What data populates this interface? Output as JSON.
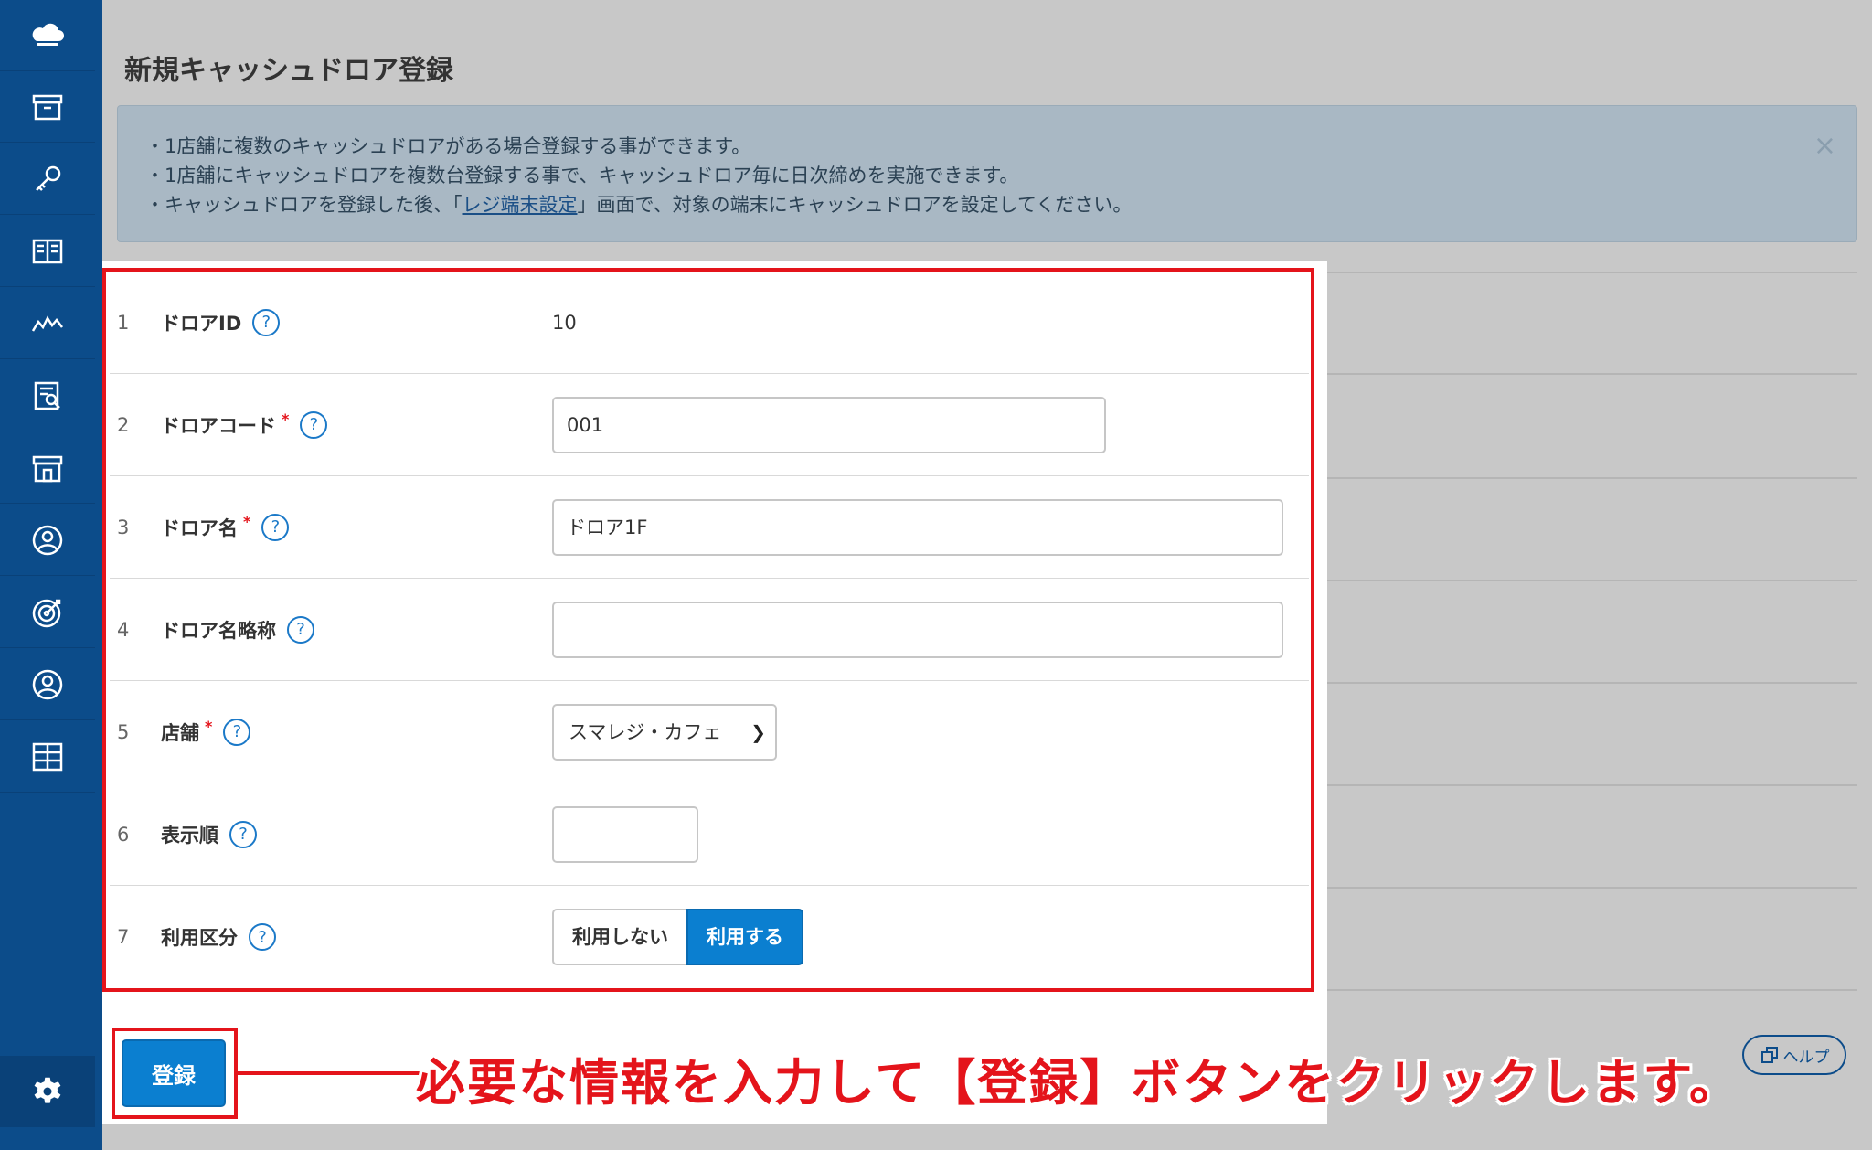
{
  "page": {
    "title": "新規キャッシュドロア登録"
  },
  "sidebar": {
    "items": [
      {
        "icon": "cloud-icon"
      },
      {
        "icon": "archive-icon"
      },
      {
        "icon": "key-icon"
      },
      {
        "icon": "book-icon"
      },
      {
        "icon": "chart-line-icon"
      },
      {
        "icon": "report-icon"
      },
      {
        "icon": "store-icon"
      },
      {
        "icon": "user-icon"
      },
      {
        "icon": "target-icon"
      },
      {
        "icon": "member-icon"
      },
      {
        "icon": "apps-icon"
      }
    ],
    "settings_icon": "gear-icon"
  },
  "alert": {
    "line1": "・1店舗に複数のキャッシュドロアがある場合登録する事ができます。",
    "line2": "・1店舗にキャッシュドロアを複数台登録する事で、キャッシュドロア毎に日次締めを実施できます。",
    "line3_prefix": "・キャッシュドロアを登録した後、「",
    "line3_link": "レジ端末設定",
    "line3_suffix": "」画面で、対象の端末にキャッシュドロアを設定してください。",
    "close": "×"
  },
  "form": {
    "rows": [
      {
        "num": "1",
        "label": "ドロアID",
        "value": "10"
      },
      {
        "num": "2",
        "label": "ドロアコード",
        "required_mark": "*",
        "value": "001"
      },
      {
        "num": "3",
        "label": "ドロア名",
        "required_mark": "*",
        "value": "ドロア1F"
      },
      {
        "num": "4",
        "label": "ドロア名略称",
        "value": ""
      },
      {
        "num": "5",
        "label": "店舗",
        "required_mark": "*",
        "value": "スマレジ・カフェ"
      },
      {
        "num": "6",
        "label": "表示順",
        "value": ""
      },
      {
        "num": "7",
        "label": "利用区分",
        "options": [
          "利用しない",
          "利用する"
        ],
        "selected": "利用する"
      }
    ],
    "help_glyph": "?"
  },
  "actions": {
    "register_label": "登録",
    "help_label": "ヘルプ"
  },
  "annotation": {
    "callout": "必要な情報を入力して【登録】ボタンをクリックします。"
  }
}
